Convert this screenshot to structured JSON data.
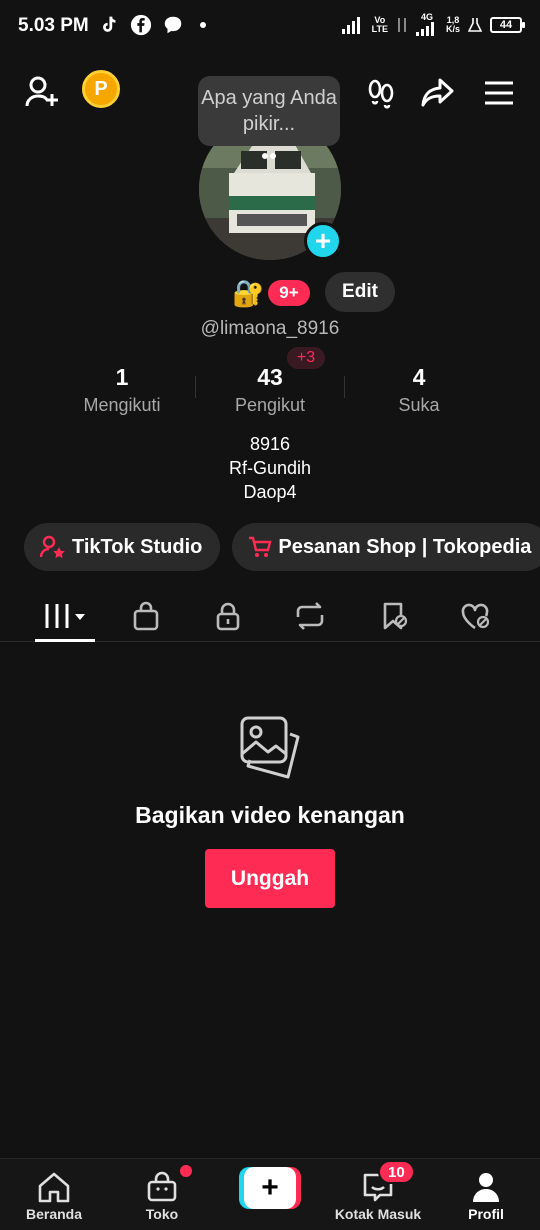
{
  "status_bar": {
    "time": "5.03 PM",
    "network_top": "Vo",
    "network_bottom": "LTE",
    "gen": "4G",
    "speed_top": "1,8",
    "speed_bottom": "K/s",
    "battery": "44"
  },
  "header": {
    "thought_bubble": "Apa yang Anda pikir..."
  },
  "profile": {
    "notifications_badge": "9+",
    "edit_label": "Edit",
    "username": "@limaona_8916",
    "followers_delta": "+3",
    "stats": [
      {
        "num": "1",
        "label": "Mengikuti"
      },
      {
        "num": "43",
        "label": "Pengikut"
      },
      {
        "num": "4",
        "label": "Suka"
      }
    ],
    "bio_lines": [
      "8916",
      "Rf-Gundih",
      "Daop4"
    ]
  },
  "chips": [
    {
      "label": "TikTok Studio"
    },
    {
      "label": "Pesanan Shop | Tokopedia"
    }
  ],
  "empty_state": {
    "message": "Bagikan video kenangan",
    "button": "Unggah"
  },
  "bottom_nav": [
    {
      "label": "Beranda"
    },
    {
      "label": "Toko"
    },
    {
      "label": ""
    },
    {
      "label": "Kotak Masuk"
    },
    {
      "label": "Profil"
    }
  ],
  "inbox_badge": "10",
  "colors": {
    "accent": "#fe2c55",
    "cyan": "#20d5ec",
    "background": "#121212"
  }
}
